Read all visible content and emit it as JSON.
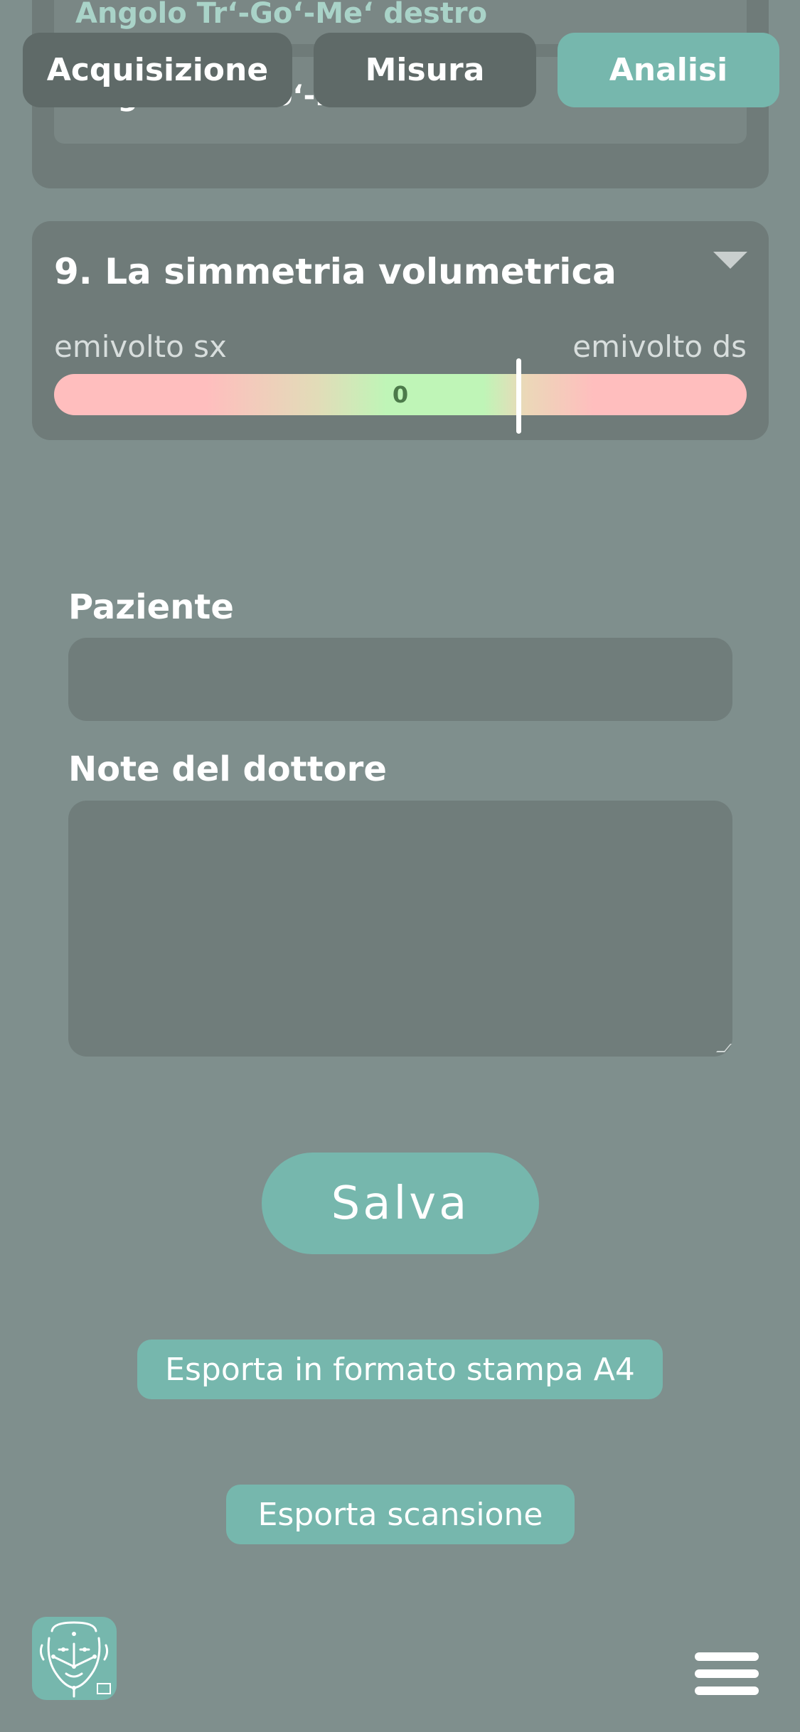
{
  "top_card": {
    "row1_label": "Angolo Tr‘-Go‘-Me‘ destro",
    "row2_label": "Angolo Tr‘-Go‘-Me‘ sinistro"
  },
  "tabs": [
    {
      "label": "Acquisizione",
      "active": false
    },
    {
      "label": "Misura",
      "active": false
    },
    {
      "label": "Analisi",
      "active": true
    }
  ],
  "symmetry": {
    "title": "9. La simmetria volumetrica",
    "left_label": "emivolto sx",
    "right_label": "emivolto ds",
    "value": "0",
    "marker_fraction": 0.67
  },
  "form": {
    "patient_label": "Paziente",
    "patient_value": "",
    "notes_label": "Note del dottore",
    "notes_value": ""
  },
  "buttons": {
    "save": "Salva",
    "export_a4": "Esporta in formato stampa A4",
    "export_scan": "Esporta scansione"
  },
  "colors": {
    "background": "#7f8f8d",
    "card": "#6f7b79",
    "accent": "#76b7ad"
  },
  "icons": {
    "logo": "face-scan-logo-icon",
    "menu": "hamburger-menu-icon",
    "dropdown": "chevron-down-icon"
  }
}
